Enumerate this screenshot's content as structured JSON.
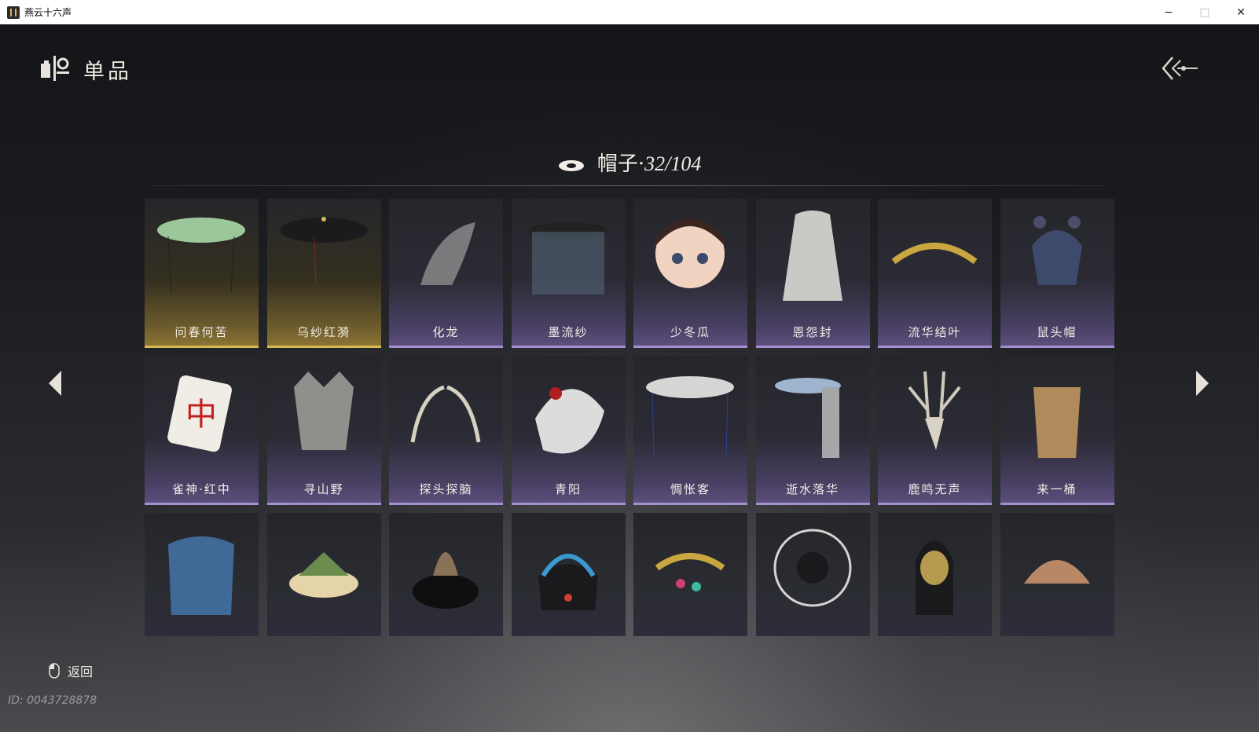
{
  "window": {
    "title": "燕云十六声",
    "minimize": "−",
    "maximize": "□",
    "close": "✕"
  },
  "header": {
    "title": "单品"
  },
  "category": {
    "name": "帽子·",
    "count": "32/104"
  },
  "items": [
    {
      "name": "问春何苦",
      "rarity": "gold",
      "icon": "bamboo-hat-icon"
    },
    {
      "name": "乌纱红漪",
      "rarity": "gold",
      "icon": "black-veil-hat-icon"
    },
    {
      "name": "化龙",
      "rarity": "purple",
      "icon": "dragon-head-icon"
    },
    {
      "name": "墨流纱",
      "rarity": "purple",
      "icon": "veil-hat-icon"
    },
    {
      "name": "少冬瓜",
      "rarity": "purple",
      "icon": "doll-head-icon"
    },
    {
      "name": "恩怨封",
      "rarity": "purple",
      "icon": "hood-icon"
    },
    {
      "name": "流华结叶",
      "rarity": "purple",
      "icon": "golden-wreath-icon"
    },
    {
      "name": "鼠头帽",
      "rarity": "purple",
      "icon": "mouse-hat-icon"
    },
    {
      "name": "雀神·红中",
      "rarity": "purple",
      "icon": "mahjong-tile-icon"
    },
    {
      "name": "寻山野",
      "rarity": "purple",
      "icon": "wolf-head-icon"
    },
    {
      "name": "探头探脑",
      "rarity": "purple",
      "icon": "feathers-icon"
    },
    {
      "name": "青阳",
      "rarity": "purple",
      "icon": "white-hat-icon"
    },
    {
      "name": "惆怅客",
      "rarity": "purple",
      "icon": "white-bamboo-hat-icon"
    },
    {
      "name": "逝水落华",
      "rarity": "purple",
      "icon": "lace-hat-icon"
    },
    {
      "name": "鹿鸣无声",
      "rarity": "purple",
      "icon": "deer-skull-icon"
    },
    {
      "name": "来一桶",
      "rarity": "purple",
      "icon": "bucket-hat-icon"
    },
    {
      "name": "",
      "rarity": "none",
      "icon": "blue-cloak-hat-icon"
    },
    {
      "name": "",
      "rarity": "none",
      "icon": "zongzi-hat-icon"
    },
    {
      "name": "",
      "rarity": "none",
      "icon": "fur-hat-icon"
    },
    {
      "name": "",
      "rarity": "none",
      "icon": "phoenix-crown-icon"
    },
    {
      "name": "",
      "rarity": "none",
      "icon": "jeweled-hairpiece-icon"
    },
    {
      "name": "",
      "rarity": "none",
      "icon": "wire-fan-hat-icon"
    },
    {
      "name": "",
      "rarity": "none",
      "icon": "golden-helmet-icon"
    },
    {
      "name": "",
      "rarity": "none",
      "icon": "wooden-bowl-icon"
    }
  ],
  "footer": {
    "back_label": "返回",
    "uid": "ID: 0043728878"
  },
  "colors": {
    "gold": "#d7b957",
    "purple": "#a58fd0"
  }
}
